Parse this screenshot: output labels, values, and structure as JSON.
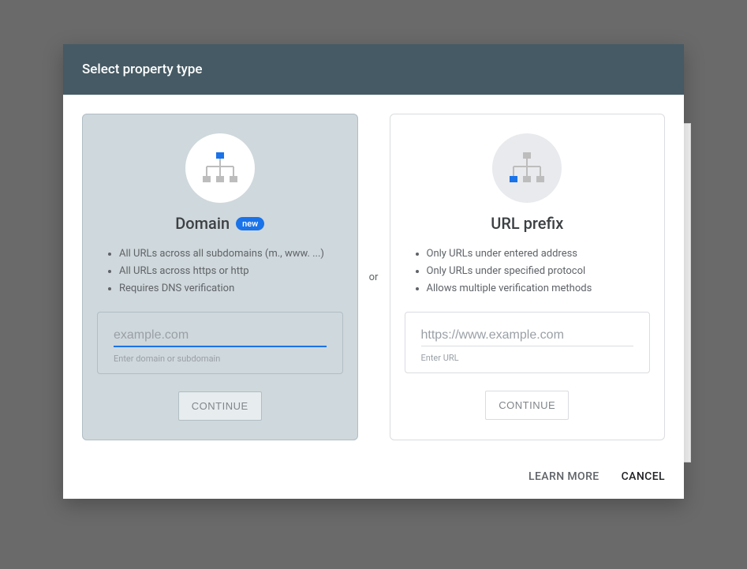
{
  "modal": {
    "title": "Select property type",
    "separator": "or",
    "footer": {
      "learn_more": "LEARN MORE",
      "cancel": "CANCEL"
    }
  },
  "domain_card": {
    "title": "Domain",
    "badge": "new",
    "features": [
      "All URLs across all subdomains (m., www. ...)",
      "All URLs across https or http",
      "Requires DNS verification"
    ],
    "input_placeholder": "example.com",
    "input_value": "",
    "helper": "Enter domain or subdomain",
    "continue": "CONTINUE"
  },
  "urlprefix_card": {
    "title": "URL prefix",
    "features": [
      "Only URLs under entered address",
      "Only URLs under specified protocol",
      "Allows multiple verification methods"
    ],
    "input_placeholder": "https://www.example.com",
    "input_value": "",
    "helper": "Enter URL",
    "continue": "CONTINUE"
  },
  "colors": {
    "header_bg": "#455a64",
    "accent": "#1a73e8",
    "domain_bg": "#cfd8dc"
  }
}
